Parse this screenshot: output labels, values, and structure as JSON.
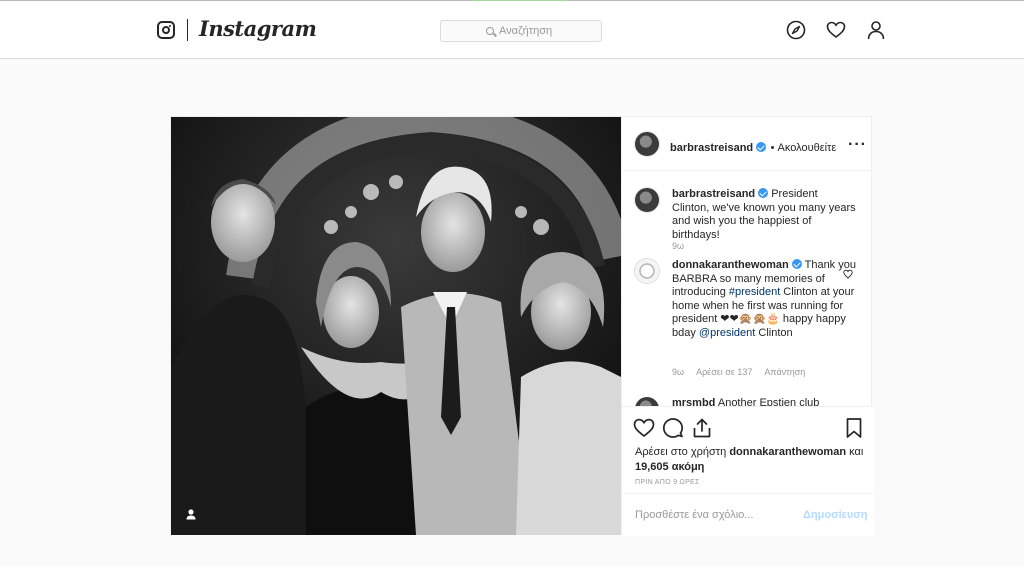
{
  "header": {
    "wordmark": "Instagram",
    "search_placeholder": "Αναζήτηση"
  },
  "post": {
    "author": "barbrastreisand",
    "follow_label": "• Ακολουθείτε",
    "comments": [
      {
        "username": "barbrastreisand",
        "text": "President Clinton, we've known you many years and wish you the happiest of birthdays!",
        "time": "9ω"
      },
      {
        "username": "donnakaranthewoman",
        "text_before": "Thank you BARBRA so many memories of introducing ",
        "hashtag": "#president",
        "text_middle": " Clinton at your home when he first was running for president ❤❤🙊🙊🎂 happy happy bday ",
        "mention": "@president",
        "text_after": " Clinton",
        "time": "9ω",
        "likes": "Αρέσει σε 137",
        "reply": "Απάντηση"
      },
      {
        "username": "mrsmbd",
        "text": "Another Epstien club"
      }
    ],
    "likes_text": "Αρέσει στο χρήστη",
    "likes_user": "donnakaranthewoman",
    "likes_and": "και",
    "likes_more": "19,605 ακόμη",
    "timestamp": "ΠΡΙΝ ΑΠΟ 9 ΩΡΕΣ",
    "add_comment_placeholder": "Προσθέστε ένα σχόλιο...",
    "post_button": "Δημοσίευση"
  },
  "colors": {
    "accent": "#3897f0",
    "link": "#003569",
    "post_button_disabled": "#b3dbff"
  }
}
